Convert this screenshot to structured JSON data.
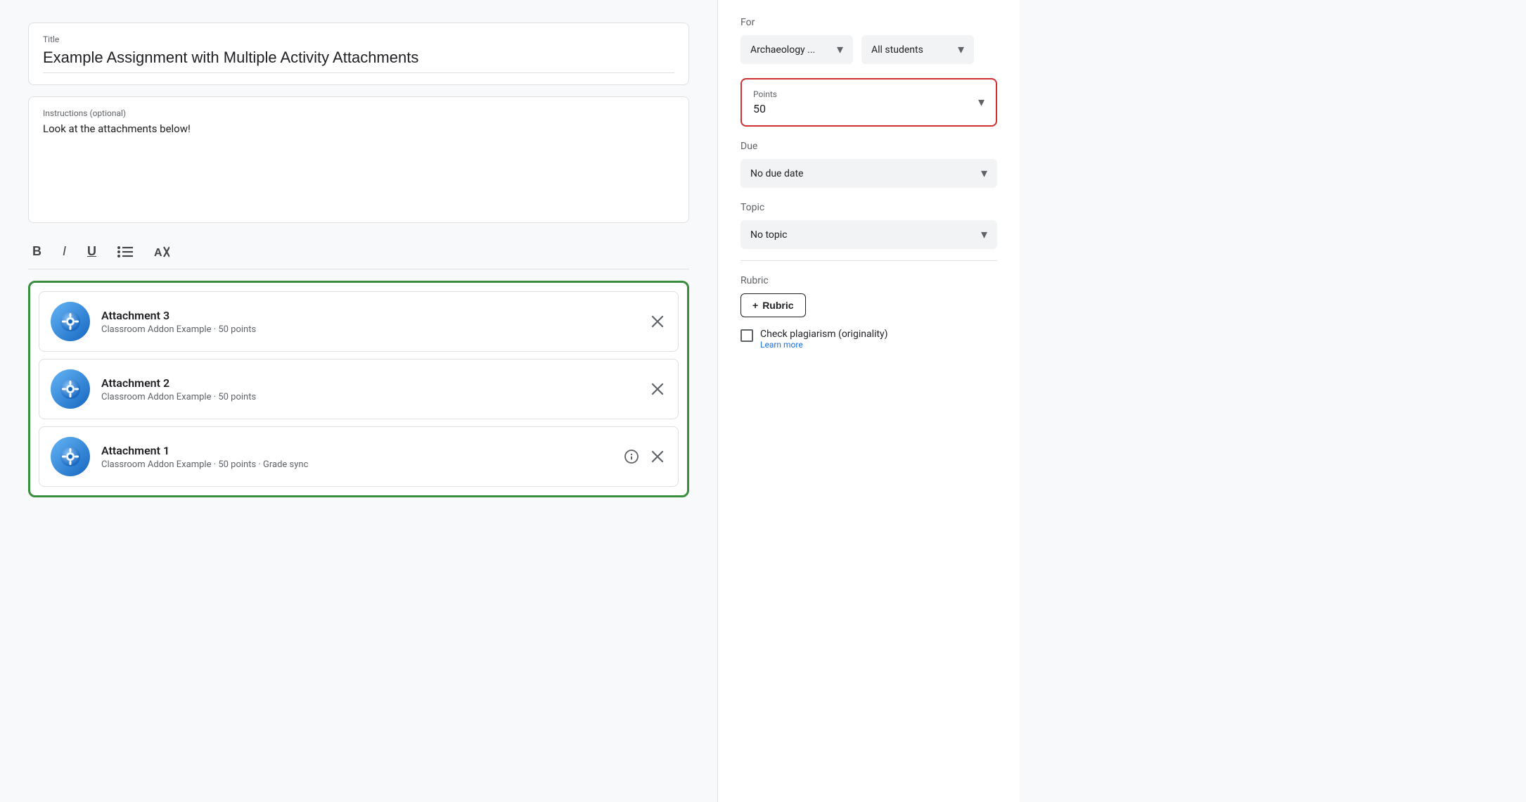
{
  "title_field": {
    "label": "Title",
    "value": "Example Assignment with Multiple Activity Attachments"
  },
  "instructions_field": {
    "label": "Instructions (optional)",
    "value": "Look at the attachments below!"
  },
  "toolbar": {
    "bold": "B",
    "italic": "I",
    "underline": "U",
    "list": "☰",
    "clear": "✕"
  },
  "attachments": [
    {
      "name": "Attachment 3",
      "meta": "Classroom Addon Example · 50 points",
      "has_info": false
    },
    {
      "name": "Attachment 2",
      "meta": "Classroom Addon Example · 50 points",
      "has_info": false
    },
    {
      "name": "Attachment 1",
      "meta": "Classroom Addon Example · 50 points · Grade sync",
      "has_info": true
    }
  ],
  "sidebar": {
    "for_label": "For",
    "class_dropdown": "Archaeology ...",
    "students_dropdown": "All students",
    "points_label": "Points",
    "points_value": "50",
    "due_label": "Due",
    "due_dropdown": "No due date",
    "topic_label": "Topic",
    "topic_dropdown": "No topic",
    "rubric_label": "Rubric",
    "rubric_btn": "Rubric",
    "rubric_plus": "+",
    "plagiarism_label": "Check plagiarism (originality)",
    "learn_more": "Learn more"
  }
}
